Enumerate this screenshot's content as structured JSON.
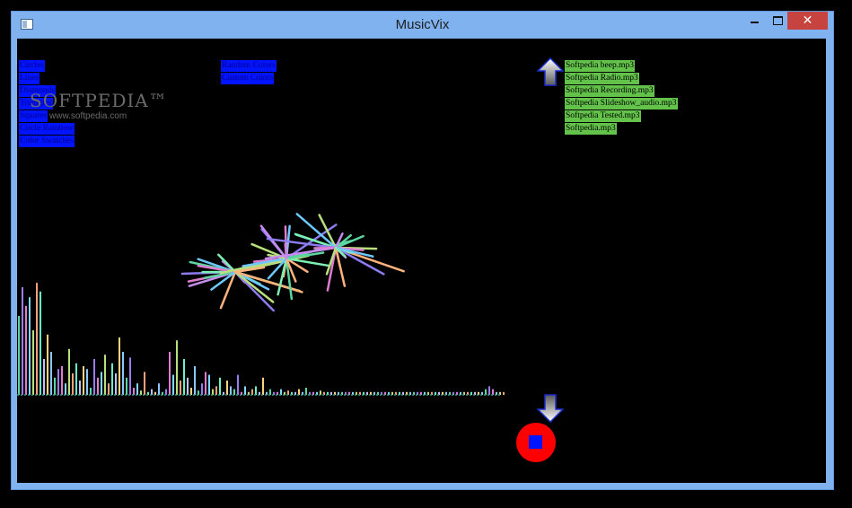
{
  "window": {
    "title": "MusicVix",
    "close_glyph": "✕",
    "controls": [
      "minimize-icon",
      "maximize-icon",
      "close-icon"
    ]
  },
  "watermark": {
    "logo": "SOFTPEDIA™",
    "url": "www.softpedia.com"
  },
  "blue_menu_left": [
    {
      "label": "Circles"
    },
    {
      "label": "Lines"
    },
    {
      "label": "Diamonds"
    },
    {
      "label": "Triangles"
    },
    {
      "label": "Squares"
    },
    {
      "label": "Circle Rainbow"
    },
    {
      "label": "Color Swatches"
    }
  ],
  "blue_menu_right": [
    {
      "label": "Random Colors"
    },
    {
      "label": "Custom Colors"
    }
  ],
  "playlist": [
    {
      "label": "Softpedia beep.mp3"
    },
    {
      "label": "Softpedia Radio.mp3"
    },
    {
      "label": "Softpedia Recording.mp3"
    },
    {
      "label": "Softpedia Slideshow_audio.mp3"
    },
    {
      "label": "Softpedia Tested.mp3"
    },
    {
      "label": "Softpedia.mp3"
    }
  ],
  "controls": {
    "scroll_up_icon": "arrow-up-icon",
    "scroll_down_icon": "arrow-down-icon",
    "stop_icon": "stop-icon"
  },
  "colors": {
    "menu_blue": "#0014ff",
    "playlist_green": "#62c24a",
    "stop_red": "#ff0000",
    "titlebar": "#7fb2ee"
  },
  "visualizer": {
    "spectrum_levels": [
      0.55,
      0.75,
      0.62,
      0.68,
      0.45,
      0.78,
      0.72,
      0.25,
      0.42,
      0.3,
      0.12,
      0.18,
      0.2,
      0.08,
      0.32,
      0.15,
      0.22,
      0.1,
      0.2,
      0.18,
      0.05,
      0.25,
      0.12,
      0.16,
      0.28,
      0.08,
      0.22,
      0.15,
      0.4,
      0.3,
      0.12,
      0.26,
      0.05,
      0.08,
      0.03,
      0.16,
      0.02,
      0.04,
      0.02,
      0.08,
      0.02,
      0.04,
      0.3,
      0.14,
      0.38,
      0.1,
      0.25,
      0.12,
      0.05,
      0.2,
      0.03,
      0.08,
      0.16,
      0.14,
      0.04,
      0.06,
      0.12,
      0.02,
      0.1,
      0.06,
      0.04,
      0.14,
      0.02,
      0.06,
      0.02,
      0.04,
      0.06,
      0.02,
      0.12,
      0.02,
      0.04,
      0.02,
      0.02,
      0.04,
      0.02,
      0.03,
      0.02,
      0.02,
      0.04,
      0.02,
      0.05,
      0.02,
      0.02,
      0.02,
      0.03,
      0.02,
      0.02,
      0.02,
      0.02,
      0.02,
      0.02,
      0.02,
      0.02,
      0.02,
      0.02,
      0.02,
      0.02,
      0.02,
      0.02,
      0.02,
      0.02,
      0.02,
      0.02,
      0.02,
      0.02,
      0.02,
      0.02,
      0.02,
      0.02,
      0.02,
      0.02,
      0.02,
      0.02,
      0.02,
      0.02,
      0.02,
      0.02,
      0.02,
      0.02,
      0.02,
      0.02,
      0.02,
      0.02,
      0.02,
      0.02,
      0.02,
      0.02,
      0.02,
      0.02,
      0.02,
      0.04,
      0.06,
      0.04,
      0.02,
      0.02,
      0.02
    ],
    "bar_colors": [
      "#5bd6a0",
      "#9b7cf0",
      "#e07cd0",
      "#7fd8ff",
      "#b8e07c",
      "#ff9f7c",
      "#6cf0c8",
      "#c0c0ff",
      "#ffd27c",
      "#8cc8ff"
    ],
    "burst_colors": [
      "#8c7cf0",
      "#5bd6a0",
      "#e07cd0",
      "#b8e07c",
      "#6cc8ff",
      "#ffb27c",
      "#c88cf0",
      "#7cf0b0"
    ]
  }
}
